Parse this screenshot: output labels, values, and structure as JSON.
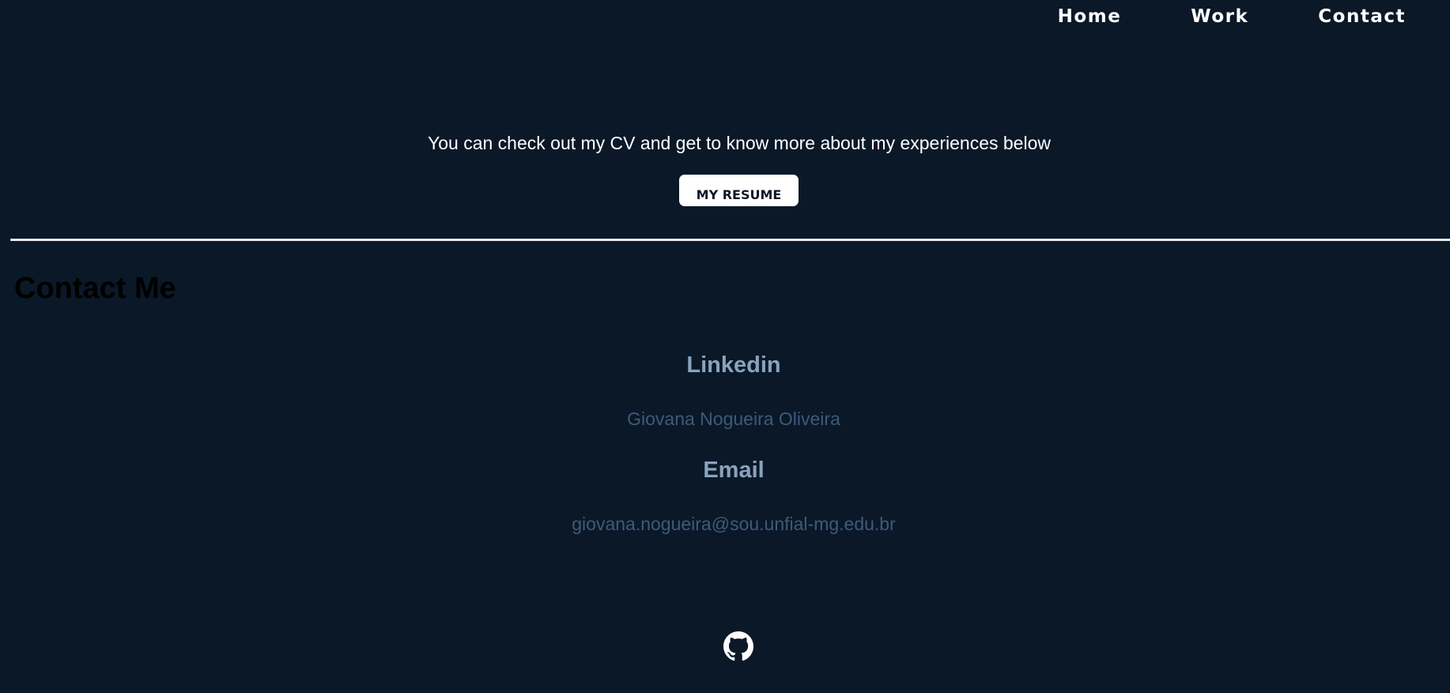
{
  "nav": {
    "items": [
      {
        "label": "Home"
      },
      {
        "label": "Work"
      },
      {
        "label": "Contact"
      }
    ]
  },
  "resume": {
    "intro_text": "You can check out my CV and get to know more about my experiences below",
    "button_label": "MY RESUME"
  },
  "contact": {
    "title": "Contact Me",
    "linkedin": {
      "heading": "Linkedin",
      "value": "Giovana Nogueira Oliveira"
    },
    "email": {
      "heading": "Email",
      "value": "giovana.nogueira@sou.unfial-mg.edu.br"
    }
  },
  "footer": {
    "icons": [
      "github-icon"
    ]
  },
  "colors": {
    "background": "#0a1828",
    "heading_accent": "#8aa3bd",
    "muted_link": "#3f5a79"
  }
}
